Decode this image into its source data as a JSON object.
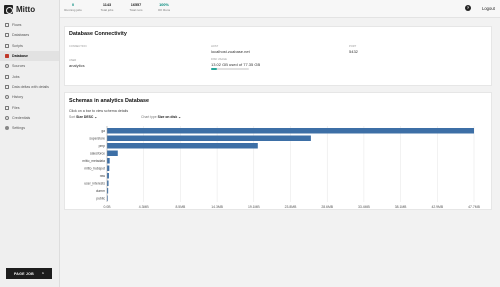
{
  "app": {
    "name": "Mitto"
  },
  "stats": [
    {
      "value": "0",
      "label": "Running jobs",
      "color": "#00897b"
    },
    {
      "value": "1143",
      "label": "Total jobs",
      "color": "#222222"
    },
    {
      "value": "16557",
      "label": "Total runs",
      "color": "#222222"
    },
    {
      "value": "100%",
      "label": "OK Runs",
      "color": "#00897b"
    }
  ],
  "topbar": {
    "help": "?",
    "logout": "Logout"
  },
  "sidebar": {
    "items": [
      {
        "label": "Flows",
        "icon": "flow-icon"
      },
      {
        "label": "Databases",
        "icon": "databases-icon"
      },
      {
        "label": "Scripts",
        "icon": "scripts-icon"
      },
      {
        "label": "Database",
        "icon": "database-icon",
        "active": true
      },
      {
        "label": "Sources",
        "icon": "sources-icon"
      },
      {
        "label": "Jobs",
        "icon": "jobs-icon"
      },
      {
        "label": "Data deltas with details",
        "icon": "deltas-icon"
      },
      {
        "label": "History",
        "icon": "history-icon"
      },
      {
        "label": "Files",
        "icon": "files-icon"
      },
      {
        "label": "Credentials",
        "icon": "credentials-icon"
      },
      {
        "label": "Settings",
        "icon": "settings-icon"
      }
    ],
    "page_job": "PAGE JOB",
    "page_job_caret": "^"
  },
  "connectivity": {
    "title": "Database Connectivity",
    "connection_label": "CONNECTION",
    "connection_value": "",
    "host_label": "HOST",
    "host_value": "localhost.zuabase.net",
    "port_label": "PORT",
    "port_value": "5432",
    "user_label": "USER",
    "user_value": "analytics",
    "disk_label": "DISK USAGE",
    "disk_value": "13.02 GB used of 77.35 GB",
    "disk_fraction": 0.168
  },
  "schemas": {
    "title": "Schemas in analytics Database",
    "hint": "Click on a bar to view schema details",
    "sort_label": "Sort",
    "sort_value": "Size DESC",
    "chart_type_label": "Chart type",
    "chart_type_value": "Size on disk"
  },
  "chart_data": {
    "type": "bar",
    "orientation": "horizontal",
    "categories": [
      "ga",
      "superstore",
      "pmp",
      "salesforce",
      "mitto_metadata",
      "mitto_hubspot",
      "raw",
      "user_interests",
      "dumm",
      "public"
    ],
    "values": [
      47.7,
      26.5,
      19.6,
      1.4,
      0.35,
      0.3,
      0.25,
      0.2,
      0.15,
      0.1
    ],
    "xlim": [
      0,
      47.7
    ],
    "xticks": [
      "0.0B",
      "4.3MB",
      "8.5MB",
      "14.3MB",
      "19.1MB",
      "23.8MB",
      "28.6MB",
      "33.4MB",
      "38.1MB",
      "42.9MB",
      "47.7MB"
    ],
    "bar_color": "#3d6fa6",
    "grid": true
  }
}
